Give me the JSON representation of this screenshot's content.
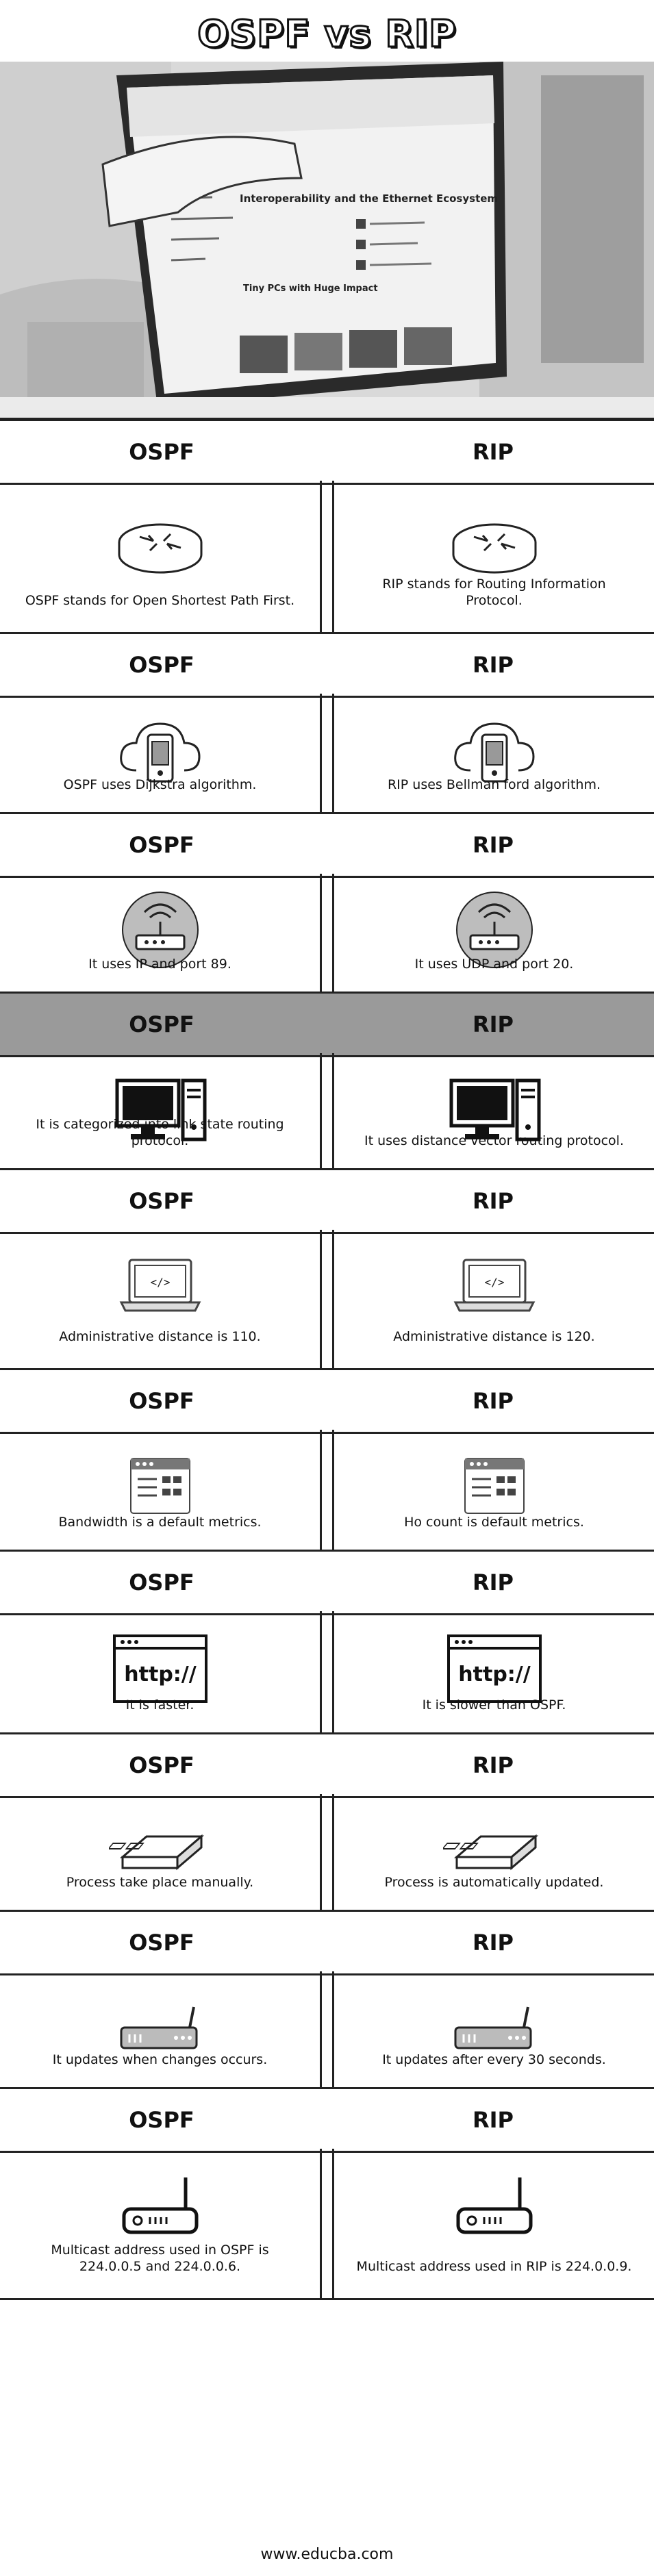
{
  "title": "OSPF vs RIP",
  "footer": "www.educba.com",
  "hero": {
    "browser_heading": "Interoperability and the Ethernet Ecosystem",
    "browser_subheading": "Tiny PCs with Huge Impact"
  },
  "rows": [
    {
      "left_label": "OSPF",
      "right_label": "RIP",
      "icon": "router-icon",
      "left_text": "OSPF stands for Open Shortest Path First.",
      "right_text": "RIP stands for Routing Information Protocol."
    },
    {
      "left_label": "OSPF",
      "right_label": "RIP",
      "icon": "phone-cloud-icon",
      "left_text": "OSPF uses Dijkstra algorithm.",
      "right_text": "RIP uses Bellman ford algorithm."
    },
    {
      "left_label": "OSPF",
      "right_label": "RIP",
      "icon": "wifi-router-icon",
      "left_text": "It uses IP and port 89.",
      "right_text": "It uses UDP and port 20."
    },
    {
      "left_label": "OSPF",
      "right_label": "RIP",
      "icon": "desktop-computer-icon",
      "left_text": "It is categorized into link state routing protocol.",
      "right_text": "It uses distance vector routing protocol."
    },
    {
      "left_label": "OSPF",
      "right_label": "RIP",
      "icon": "laptop-code-icon",
      "left_text": "Administrative distance is 110.",
      "right_text": "Administrative distance is 120."
    },
    {
      "left_label": "OSPF",
      "right_label": "RIP",
      "icon": "browser-dashboard-icon",
      "left_text": "Bandwidth is a default metrics.",
      "right_text": "Ho count is default metrics."
    },
    {
      "left_label": "OSPF",
      "right_label": "RIP",
      "icon": "http-window-icon",
      "icon_text": "http://",
      "left_text": "It is faster.",
      "right_text": "It is slower than OSPF."
    },
    {
      "left_label": "OSPF",
      "right_label": "RIP",
      "icon": "switch-icon",
      "left_text": "Process take place manually.",
      "right_text": "Process is automatically updated."
    },
    {
      "left_label": "OSPF",
      "right_label": "RIP",
      "icon": "modem-icon",
      "left_text": "It updates when changes occurs.",
      "right_text": "It updates after every 30 seconds."
    },
    {
      "left_label": "OSPF",
      "right_label": "RIP",
      "icon": "antenna-router-icon",
      "left_text": "Multicast address used in OSPF is 224.0.0.5 and 224.0.0.6.",
      "right_text": "Multicast address used in RIP is 224.0.0.9."
    }
  ]
}
